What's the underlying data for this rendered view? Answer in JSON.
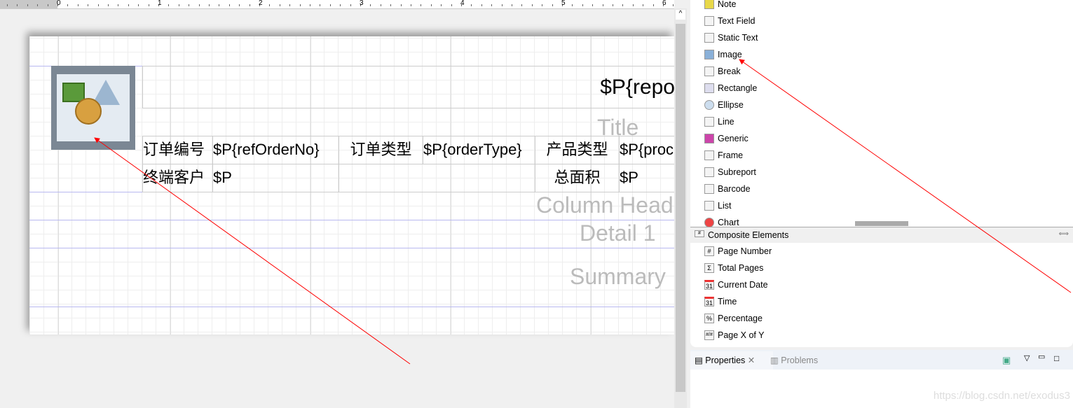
{
  "ruler": {
    "labels": [
      "0",
      "1",
      "2",
      "3",
      "4",
      "5",
      "6"
    ]
  },
  "report": {
    "title_field": "$P{repo",
    "row1": [
      "订单编号",
      "$P{refOrderNo}",
      "订单类型",
      "$P{orderType}",
      "产品类型",
      "$P{proc"
    ],
    "row2": [
      "终端客户",
      "$P",
      "",
      "总面积",
      "$P"
    ],
    "bands": [
      "Title",
      "Column Head",
      "Detail 1",
      "Summary"
    ]
  },
  "palette": {
    "basic_items": [
      {
        "label": "Note",
        "icon": "note-icon"
      },
      {
        "label": "Text Field",
        "icon": "text-field-icon"
      },
      {
        "label": "Static Text",
        "icon": "static-text-icon"
      },
      {
        "label": "Image",
        "icon": "image-icon"
      },
      {
        "label": "Break",
        "icon": "break-icon"
      },
      {
        "label": "Rectangle",
        "icon": "rectangle-icon"
      },
      {
        "label": "Ellipse",
        "icon": "ellipse-icon"
      },
      {
        "label": "Line",
        "icon": "line-icon"
      },
      {
        "label": "Generic",
        "icon": "generic-icon"
      },
      {
        "label": "Frame",
        "icon": "frame-icon"
      },
      {
        "label": "Subreport",
        "icon": "subreport-icon"
      },
      {
        "label": "Barcode",
        "icon": "barcode-icon"
      },
      {
        "label": "List",
        "icon": "list-icon"
      },
      {
        "label": "Chart",
        "icon": "chart-icon"
      }
    ],
    "composite_header": "Composite Elements",
    "composite_items": [
      {
        "label": "Page Number",
        "glyph": "#"
      },
      {
        "label": "Total Pages",
        "glyph": "Σ"
      },
      {
        "label": "Current Date",
        "glyph": "31"
      },
      {
        "label": "Time",
        "glyph": "31"
      },
      {
        "label": "Percentage",
        "glyph": "%"
      },
      {
        "label": "Page X of Y",
        "glyph": "#/#"
      }
    ]
  },
  "bottom_tabs": {
    "properties": "Properties",
    "problems": "Problems"
  },
  "watermark": "https://blog.csdn.net/exodus3",
  "colors": {
    "annotation_arrow": "#ff0000",
    "band_line": "#b8b8f0"
  }
}
